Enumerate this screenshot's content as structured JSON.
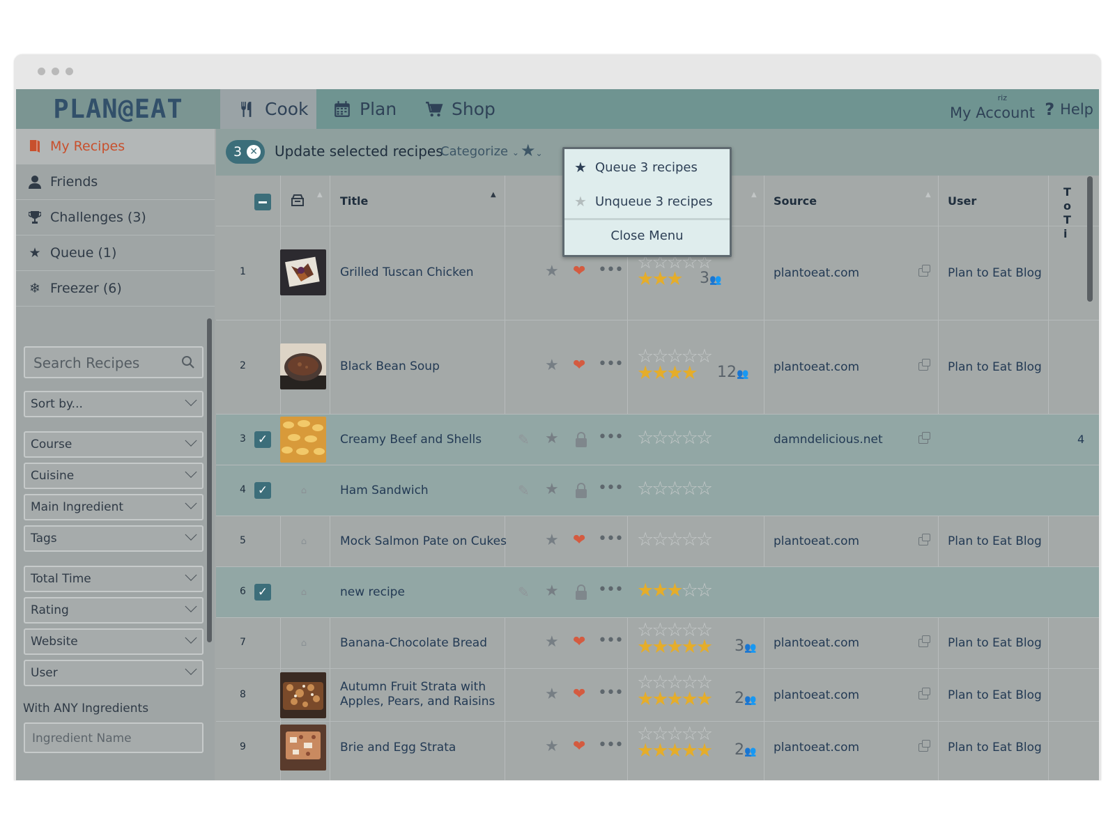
{
  "app": {
    "logo": "PLAN@EAT"
  },
  "nav": {
    "tabs": [
      {
        "label": "Cook",
        "icon": "fork-knife-icon",
        "active": true
      },
      {
        "label": "Plan",
        "icon": "calendar-icon",
        "active": false
      },
      {
        "label": "Shop",
        "icon": "cart-icon",
        "active": false
      }
    ],
    "user_initials": "riz",
    "account_label": "My Account",
    "help_label": "Help"
  },
  "sidebar": {
    "items": [
      {
        "label": "My Recipes",
        "icon": "book-icon",
        "active": true
      },
      {
        "label": "Friends",
        "icon": "person-icon",
        "active": false
      },
      {
        "label": "Challenges (3)",
        "icon": "trophy-icon",
        "active": false
      },
      {
        "label": "Queue (1)",
        "icon": "star-icon",
        "active": false
      },
      {
        "label": "Freezer (6)",
        "icon": "snowflake-icon",
        "active": false
      }
    ],
    "search_placeholder": "Search Recipes",
    "filters": [
      "Sort by...",
      "Course",
      "Cuisine",
      "Main Ingredient",
      "Tags",
      "Total Time",
      "Rating",
      "Website",
      "User"
    ],
    "ingredients_label": "With ANY Ingredients",
    "ingredient_placeholder": "Ingredient Name"
  },
  "toolbar": {
    "selected_count": "3",
    "update_label": "Update selected recipes",
    "categorize_label": "Categorize"
  },
  "menu": {
    "queue_label": "Queue 3 recipes",
    "unqueue_label": "Unqueue 3 recipes",
    "close_label": "Close Menu"
  },
  "table": {
    "headers": {
      "title": "Title",
      "source": "Source",
      "user": "User",
      "total_time": "To Ti"
    },
    "rows": [
      {
        "n": "1",
        "title": "Grilled Tuscan Chicken",
        "selected": false,
        "rating": 3,
        "rating_count": "3",
        "source": "plantoeat.com",
        "user": "Plan to Eat Blog",
        "favorite": true,
        "photo": "chicken"
      },
      {
        "n": "2",
        "title": "Black Bean Soup",
        "selected": false,
        "rating": 4,
        "rating_count": "12",
        "source": "plantoeat.com",
        "user": "Plan to Eat Blog",
        "favorite": true,
        "photo": "soup"
      },
      {
        "n": "3",
        "title": "Creamy Beef and Shells",
        "selected": true,
        "rating": 0,
        "rating_count": "",
        "source": "damndelicious.net",
        "user": "",
        "favorite": false,
        "photo": "shells",
        "extra": "4"
      },
      {
        "n": "4",
        "title": "Ham Sandwich",
        "selected": true,
        "rating": 0,
        "rating_count": "",
        "source": "",
        "user": "",
        "favorite": false,
        "photo": ""
      },
      {
        "n": "5",
        "title": "Mock Salmon Pate on Cukes",
        "selected": false,
        "rating": 0,
        "rating_count": "",
        "source": "plantoeat.com",
        "user": "Plan to Eat Blog",
        "favorite": true,
        "photo": ""
      },
      {
        "n": "6",
        "title": "new recipe",
        "selected": true,
        "rating": 3,
        "rating_count": "",
        "source": "",
        "user": "",
        "favorite": false,
        "photo": ""
      },
      {
        "n": "7",
        "title": "Banana-Chocolate Bread",
        "selected": false,
        "rating": 5,
        "rating_count": "3",
        "source": "plantoeat.com",
        "user": "Plan to Eat Blog",
        "favorite": true,
        "photo": ""
      },
      {
        "n": "8",
        "title": "Autumn Fruit Strata with Apples, Pears, and Raisins",
        "selected": false,
        "rating": 5,
        "rating_count": "2",
        "source": "plantoeat.com",
        "user": "Plan to Eat Blog",
        "favorite": true,
        "photo": "strata"
      },
      {
        "n": "9",
        "title": "Brie and Egg Strata",
        "selected": false,
        "rating": 5,
        "rating_count": "2",
        "source": "plantoeat.com",
        "user": "Plan to Eat Blog",
        "favorite": true,
        "photo": "brie"
      }
    ]
  },
  "colors": {
    "nav_bg": "#6f9491",
    "accent": "#3c6e7a",
    "active_link": "#c8502d",
    "heart": "#d45b40",
    "star_fill": "#e5ad2a"
  }
}
